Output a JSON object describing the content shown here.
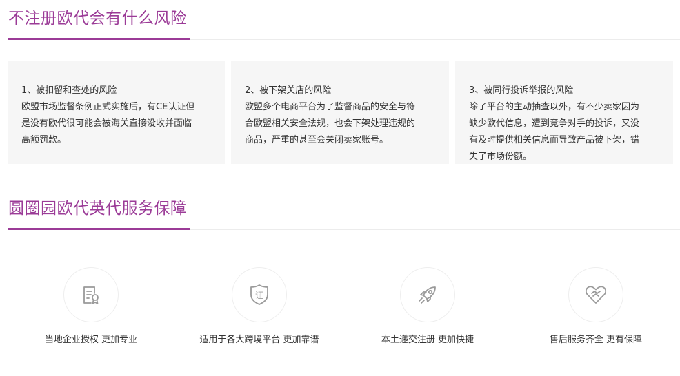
{
  "risks_section": {
    "title": "不注册欧代会有什么风险",
    "cards": [
      {
        "lines": [
          "1、被扣留和查处的风险",
          "欧盟市场监督条例正式实施后，有CE认证但",
          "是没有欧代很可能会被海关直接没收并面临",
          "高额罚款。"
        ]
      },
      {
        "lines": [
          "2、被下架关店的风险",
          "欧盟多个电商平台为了监督商品的安全与符",
          "合欧盟相关安全法规，也会下架处理违规的",
          "商品，严重的甚至会关闭卖家账号。"
        ]
      },
      {
        "lines": [
          "3、被同行投诉举报的风险",
          "除了平台的主动抽查以外，有不少卖家因为",
          "缺少欧代信息，遭到竞争对手的投诉，又没",
          "有及时提供相关信息而导致产品被下架，错",
          "失了市场份额。"
        ]
      }
    ]
  },
  "service_section": {
    "title": "圆圈园欧代英代服务保障",
    "features": [
      {
        "icon": "certificate-document-icon",
        "label": "当地企业授权 更加专业"
      },
      {
        "icon": "shield-badge-icon",
        "label": "适用于各大跨境平台 更加靠谱"
      },
      {
        "icon": "rocket-icon",
        "label": "本土递交注册 更加快捷"
      },
      {
        "icon": "heart-handshake-icon",
        "label": "售后服务齐全 更有保障"
      }
    ],
    "badge_char": "证"
  },
  "colors": {
    "accent": "#9b3b97",
    "card_bg": "#f6f6f6",
    "icon_gray": "#9a9a9a"
  }
}
